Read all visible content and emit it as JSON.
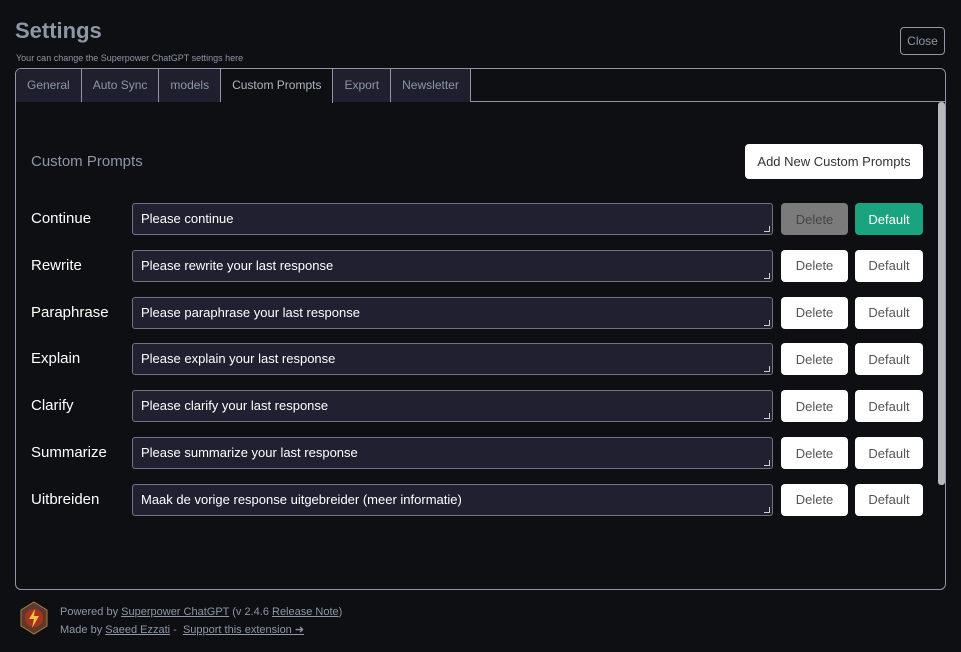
{
  "header": {
    "title": "Settings",
    "subtitle": "Your can change the Superpower ChatGPT settings here",
    "close_label": "Close"
  },
  "tabs": [
    {
      "label": "General"
    },
    {
      "label": "Auto Sync"
    },
    {
      "label": "models"
    },
    {
      "label": "Custom Prompts"
    },
    {
      "label": "Export"
    },
    {
      "label": "Newsletter"
    }
  ],
  "section": {
    "title": "Custom Prompts",
    "add_label": "Add New Custom Prompts"
  },
  "prompts": [
    {
      "name": "Continue",
      "text": "Please continue",
      "delete": "Delete",
      "default": "Default"
    },
    {
      "name": "Rewrite",
      "text": "Please rewrite your last response",
      "delete": "Delete",
      "default": "Default"
    },
    {
      "name": "Paraphrase",
      "text": "Please paraphrase your last response",
      "delete": "Delete",
      "default": "Default"
    },
    {
      "name": "Explain",
      "text": "Please explain your last response",
      "delete": "Delete",
      "default": "Default"
    },
    {
      "name": "Clarify",
      "text": "Please clarify your last response",
      "delete": "Delete",
      "default": "Default"
    },
    {
      "name": "Summarize",
      "text": "Please summarize your last response",
      "delete": "Delete",
      "default": "Default"
    },
    {
      "name": "Uitbreiden",
      "text": "Maak de vorige response uitgebreider (meer informatie)",
      "delete": "Delete",
      "default": "Default"
    }
  ],
  "footer": {
    "powered_by": "Powered by",
    "product_link": "Superpower ChatGPT",
    "version": "(v 2.4.6",
    "release_link": "Release Note",
    "version_close": ")",
    "made_by": "Made by",
    "author_link": "Saeed Ezzati",
    "separator": "-",
    "support_link": "Support this extension ➜"
  },
  "colors": {
    "accent": "#19a37f"
  }
}
